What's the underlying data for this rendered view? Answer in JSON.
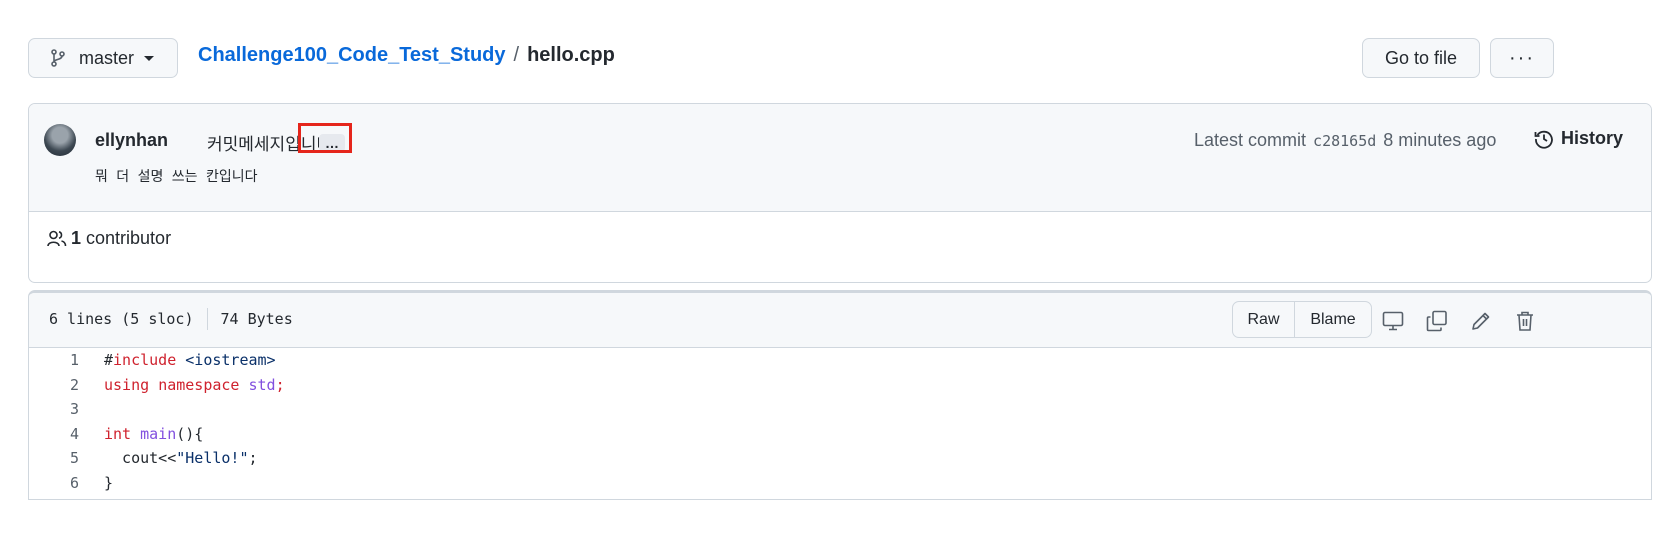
{
  "topbar": {
    "branch": "master",
    "repo": "Challenge100_Code_Test_Study",
    "separator": "/",
    "file": "hello.cpp",
    "goto_label": "Go to file",
    "more_label": "···"
  },
  "commit": {
    "author": "ellynhan",
    "message": "커밋메세지입니다",
    "ellipsis": "…",
    "description": "뭐 더 설명 쓰는 칸입니다",
    "latest_label": "Latest commit",
    "sha": "c28165d",
    "time": "8 minutes ago",
    "history_label": "History",
    "contributors_count": "1",
    "contributors_label": "contributor"
  },
  "file": {
    "lines_info": "6 lines (5 sloc)",
    "size": "74 Bytes",
    "raw_label": "Raw",
    "blame_label": "Blame",
    "code": [
      {
        "num": "1",
        "tokens": [
          {
            "t": "#",
            "c": ""
          },
          {
            "t": "include",
            "c": "kw"
          },
          {
            "t": " <iostream>",
            "c": "str"
          }
        ]
      },
      {
        "num": "2",
        "tokens": [
          {
            "t": "using",
            "c": "kw"
          },
          {
            "t": " ",
            "c": ""
          },
          {
            "t": "namespace",
            "c": "kw"
          },
          {
            "t": " ",
            "c": ""
          },
          {
            "t": "std",
            "c": "fn"
          },
          {
            "t": ";",
            "c": "kw"
          }
        ]
      },
      {
        "num": "3",
        "tokens": []
      },
      {
        "num": "4",
        "tokens": [
          {
            "t": "int",
            "c": "kw"
          },
          {
            "t": " ",
            "c": ""
          },
          {
            "t": "main",
            "c": "fn"
          },
          {
            "t": "(){",
            "c": ""
          }
        ]
      },
      {
        "num": "5",
        "tokens": [
          {
            "t": "  cout<<",
            "c": ""
          },
          {
            "t": "\"Hello!\"",
            "c": "str"
          },
          {
            "t": ";",
            "c": ""
          }
        ]
      },
      {
        "num": "6",
        "tokens": [
          {
            "t": "}",
            "c": ""
          }
        ]
      }
    ]
  },
  "icons": {
    "branch": "git-branch-icon",
    "history": "history-clock-icon",
    "people": "people-icon",
    "display": "desktop-icon",
    "copy": "copy-icon",
    "edit": "pencil-icon",
    "delete": "trash-icon"
  },
  "colors": {
    "link": "#0969da",
    "highlight_box": "#e5251b",
    "keyword": "#cf222e",
    "string": "#0a3069",
    "entity": "#8250df"
  }
}
